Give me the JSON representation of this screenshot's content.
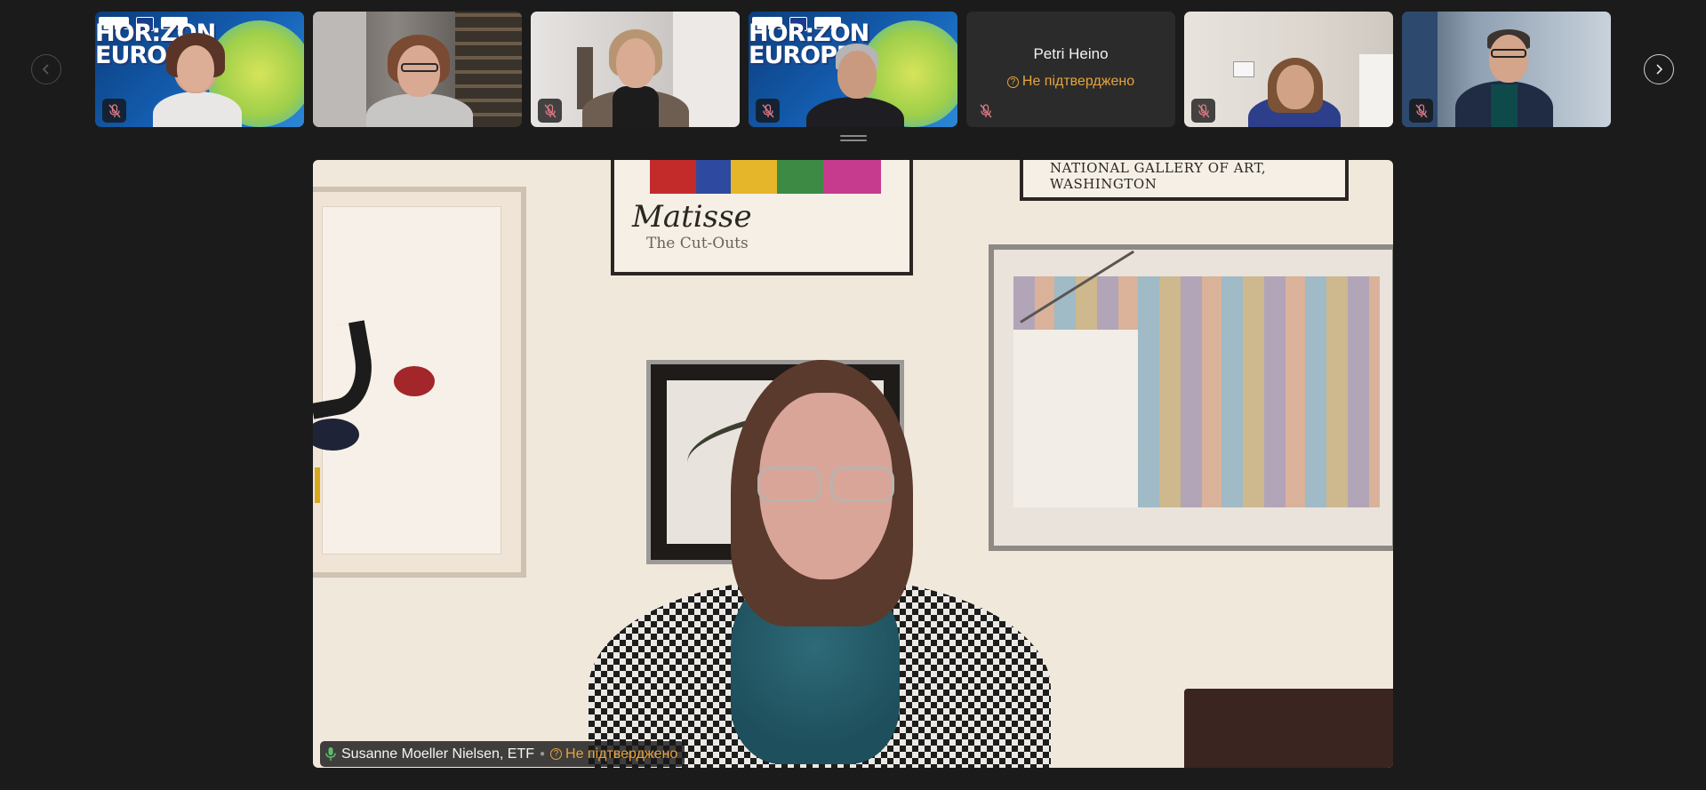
{
  "participants": [
    {
      "type": "video",
      "theme": "horizon",
      "banner": "HOR:ZON EUROPE",
      "muted": true
    },
    {
      "type": "video",
      "theme": "office",
      "muted": false
    },
    {
      "type": "video",
      "theme": "home",
      "muted": true
    },
    {
      "type": "video",
      "theme": "horizon",
      "banner": "HOR:ZON EUROPE",
      "muted": true
    },
    {
      "type": "name",
      "name": "Petri Heino",
      "status": "Не підтверджено",
      "muted": true
    },
    {
      "type": "video",
      "theme": "room",
      "muted": true
    },
    {
      "type": "video",
      "theme": "office2",
      "muted": true
    }
  ],
  "main_speaker": {
    "name": "Susanne Moeller Nielsen, ETF",
    "status": "Не підтверджено",
    "speaking": true,
    "poster_title": "Matisse",
    "poster_subtitle": "The Cut-Outs",
    "poster_banner": "NATIONAL GALLERY OF ART, WASHINGTON"
  },
  "colors": {
    "background": "#1b1b1b",
    "status_orange": "#e8a33d",
    "mic_active": "#5fbf6a",
    "mute_red": "#e07a86"
  },
  "icons": {
    "prev": "chevron-left-icon",
    "next": "chevron-right-icon",
    "muted": "mic-off-icon",
    "speaking": "mic-icon",
    "unverified": "question-circle-icon"
  }
}
